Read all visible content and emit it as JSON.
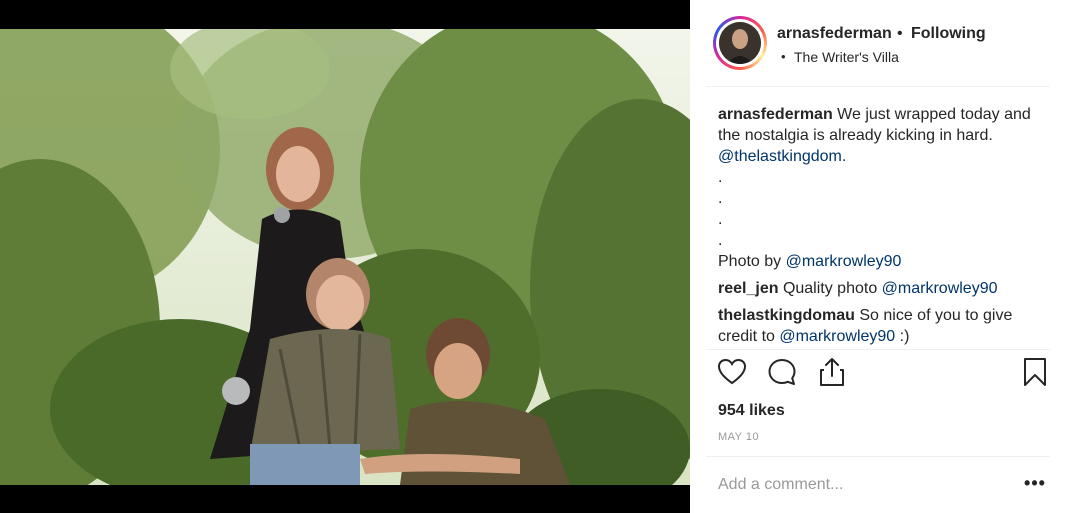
{
  "post": {
    "username": "arnasfederman",
    "separator": "•",
    "follow_status": "Following",
    "location_bullet": "•",
    "location": "The Writer's Villa",
    "likes": "954 likes",
    "date": "MAY 10",
    "comment_placeholder": "Add a comment...",
    "more_label": "•••"
  },
  "caption": {
    "username": "arnasfederman",
    "text_1": "We just wrapped today and the nostalgia is already kicking in hard.",
    "mention_1": "@thelastkingdom",
    "mention_1_suffix": ".",
    "dots": [
      ".",
      ".",
      ".",
      "."
    ],
    "photo_credit": "Photo by ",
    "mention_2": "@markrowley90"
  },
  "comments": [
    {
      "username": "reel_jen",
      "text": "Quality photo ",
      "mention": "@markrowley90",
      "suffix": ""
    },
    {
      "username": "thelastkingdomau",
      "text": "So nice of you to give credit to ",
      "mention": "@markrowley90",
      "suffix": " :)"
    }
  ],
  "icons": {
    "like": "heart-icon",
    "comment": "comment-bubble-icon",
    "share": "share-icon",
    "save": "bookmark-icon",
    "more": "more-options-icon"
  },
  "colors": {
    "text": "#262626",
    "link": "#003569",
    "muted": "#999999",
    "divider": "#efefef"
  }
}
